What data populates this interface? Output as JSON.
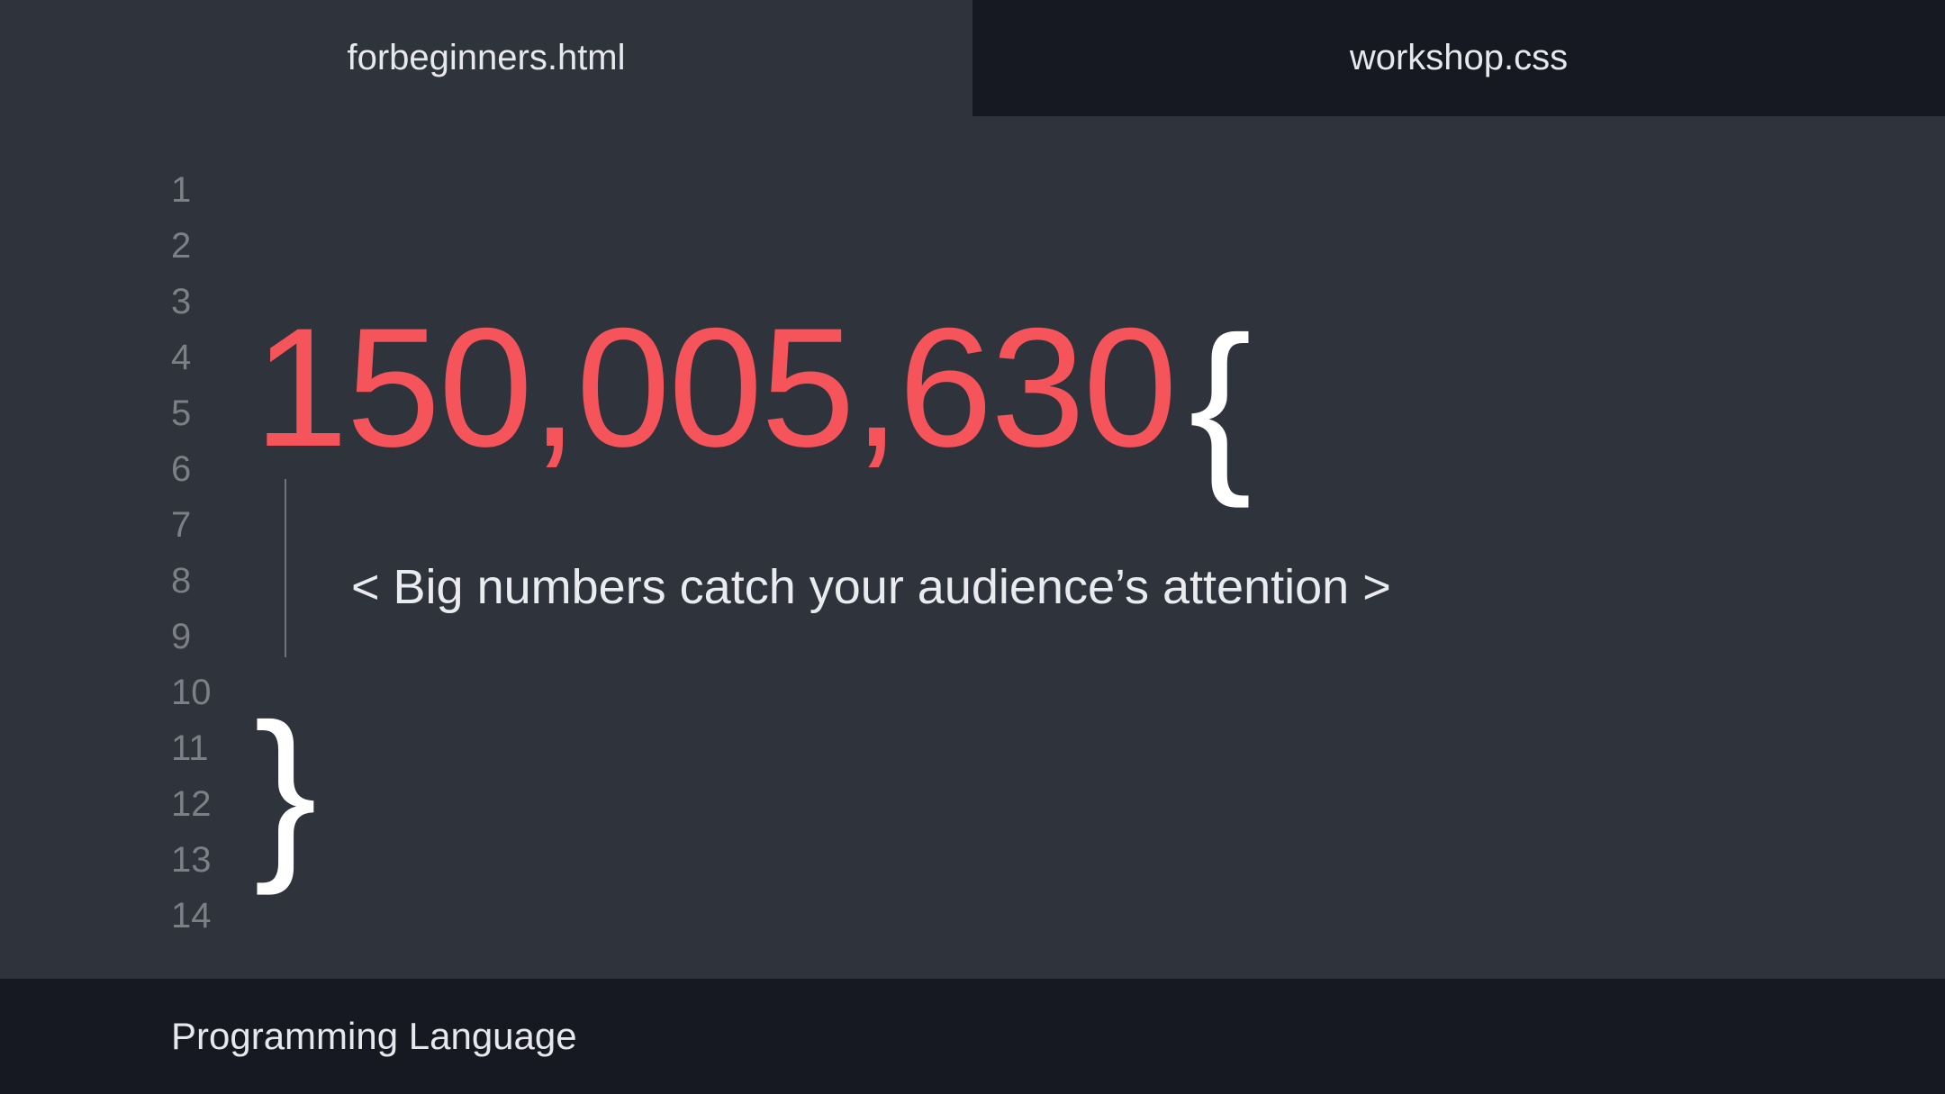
{
  "tabs": [
    {
      "label": "forbeginners.html",
      "active": true
    },
    {
      "label": "workshop.css",
      "active": false
    }
  ],
  "editor": {
    "line_numbers": [
      "1",
      "2",
      "3",
      "4",
      "5",
      "6",
      "7",
      "8",
      "9",
      "10",
      "11",
      "12",
      "13",
      "14"
    ],
    "big_number": "150,005,630",
    "open_brace": "{",
    "close_brace": "}",
    "comment": "< Big numbers catch your audience’s attention >"
  },
  "footer": {
    "label": "Programming Language"
  },
  "colors": {
    "background": "#2f333c",
    "dark_bar": "#171922",
    "accent_red": "#f4545a",
    "line_number": "#7c7f86",
    "text": "#e6e8ee"
  }
}
